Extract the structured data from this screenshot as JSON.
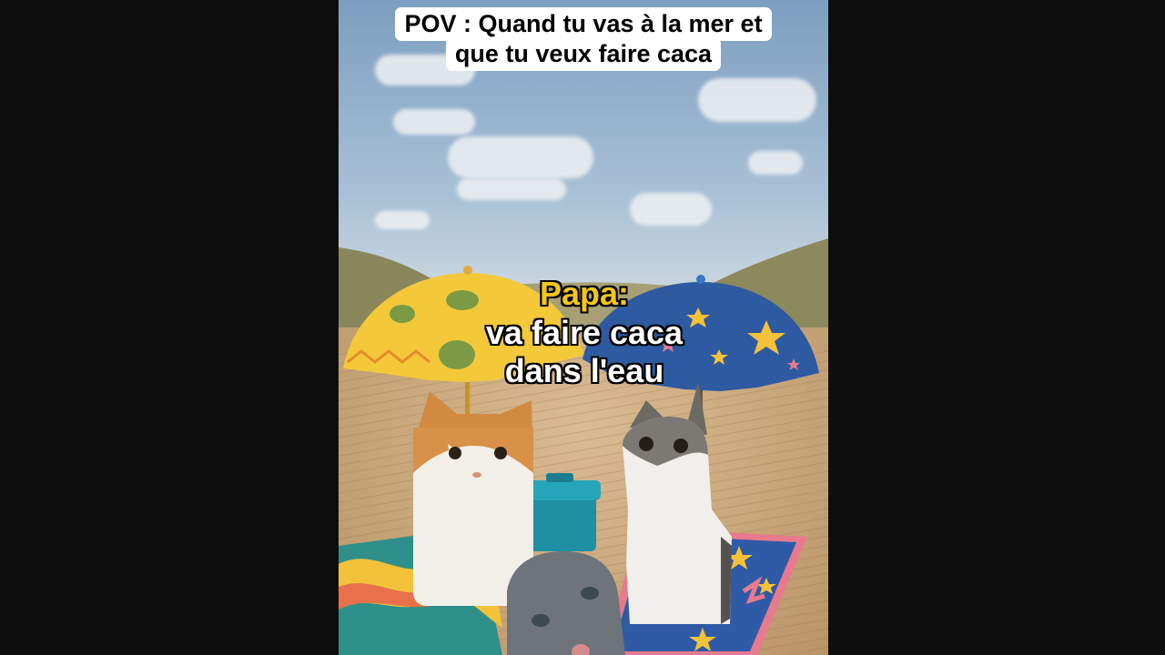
{
  "caption": {
    "line1": "POV : Quand tu vas à la mer et",
    "line2": "que tu veux faire caca"
  },
  "overlay": {
    "speaker": "Papa:",
    "line1": "va faire caca",
    "line2": "dans l'eau"
  },
  "colors": {
    "letterbox": "#0e0e0e",
    "speaker_text": "#f5c518",
    "caption_bg": "#ffffff"
  }
}
